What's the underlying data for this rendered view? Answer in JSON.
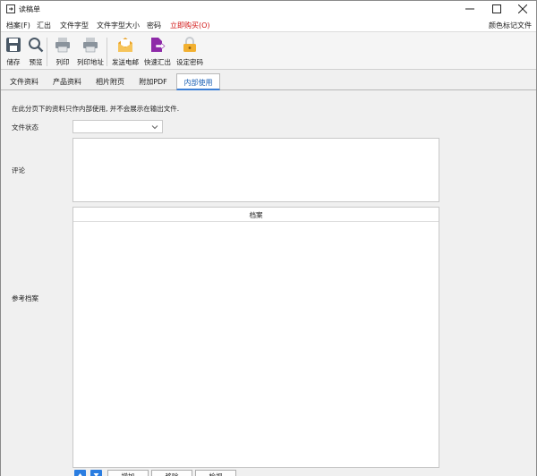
{
  "window": {
    "title": "读稿单"
  },
  "menu": {
    "items": [
      "档案(F)",
      "汇出",
      "文件字型",
      "文件字型大小",
      "密码",
      "立即购买(O)"
    ],
    "right": "颜色标记文件"
  },
  "toolbar": {
    "save": "储存",
    "preview": "预览",
    "print": "列印",
    "print_address": "列印地址",
    "send_email": "发送电邮",
    "quick_export": "快速汇出",
    "set_password": "设定密码"
  },
  "tabs": [
    "文件资料",
    "产品资料",
    "相片附页",
    "附加PDF",
    "内部使用"
  ],
  "active_tab": 4,
  "form": {
    "note": "在此分页下的资料只作内部使用, 并不会展示在输出文件.",
    "status_label": "文件状态",
    "status_value": "",
    "comment_label": "评论",
    "comment_value": "",
    "ref_label": "参考档案",
    "files_header": "档案",
    "add_label": "增加",
    "remove_label": "移除",
    "view_label": "检视"
  },
  "colors": {
    "accent": "#2a7de1",
    "menu_buy": "#d01010",
    "email_icon": "#f2b53c",
    "export_icon": "#8e2aa8",
    "lock_icon": "#e8a020"
  }
}
